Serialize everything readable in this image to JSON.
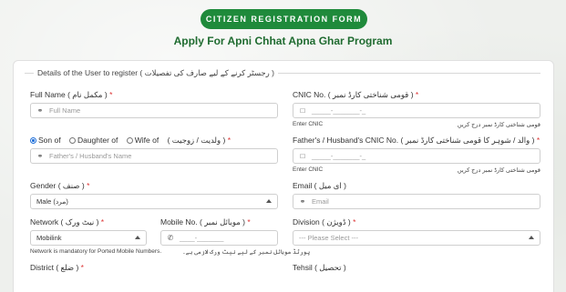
{
  "header": {
    "title": "CITIZEN REGISTRATION FORM",
    "subtitle": "Apply For Apni Chhat Apna Ghar Program"
  },
  "form": {
    "legend": "Details of the User to register ( رجسٹر کرنے کے لیے صارف کی تفصیلات )",
    "full_name": {
      "label": "Full Name ( مکمل نام )",
      "placeholder": "Full Name",
      "icon": "user-icon"
    },
    "cnic": {
      "label": "CNIC No. ( قومی شناختی کارڈ نمبر )",
      "mask": "_____-_______-_",
      "hint": "Enter CNIC",
      "hint_ur": "قومی شناختی کارڈ نمبر درج کریں",
      "icon": "card-icon"
    },
    "relation": {
      "options": [
        "Son of",
        "Daughter of",
        "Wife of"
      ],
      "selected": "Son of",
      "urdu": "( ولدیت / زوجیت )",
      "placeholder": "Father's / Husband's Name",
      "icon": "user-icon"
    },
    "father_cnic": {
      "label": "Father's / Husband's CNIC No. ( والد / شوہر کا قومی شناختی کارڈ نمبر )",
      "mask": "_____-_______-_",
      "hint": "Enter CNIC",
      "hint_ur": "قومی شناختی کارڈ نمبر درج کریں",
      "icon": "card-icon"
    },
    "gender": {
      "label": "Gender ( صنف )",
      "value": "Male (مرد)"
    },
    "email": {
      "label": "Email ( ای میل )",
      "placeholder": "Email",
      "icon": "user-icon"
    },
    "network": {
      "label": "Network ( نیٹ ورک )",
      "value": "Mobilink",
      "hint": "Network is mandatory for Ported Mobile Numbers.",
      "hint_ur": "پورٹڈ موبائل نمبر کے لیے نیٹ ورک لازمی ہے۔"
    },
    "mobile": {
      "label": "Mobile No. ( موبائل نمبر )",
      "mask": "____-_______",
      "icon": "phone-icon"
    },
    "division": {
      "label": "Division ( ڈویژن )",
      "value": "--- Please Select ---"
    },
    "district": {
      "label": "District ( ضلع )"
    },
    "tehsil": {
      "label": "Tehsil ( تحصیل )"
    },
    "required_mark": "*"
  },
  "colors": {
    "accent": "#1f8a3b",
    "title_text": "#1f6b30",
    "required": "#dd3333"
  }
}
